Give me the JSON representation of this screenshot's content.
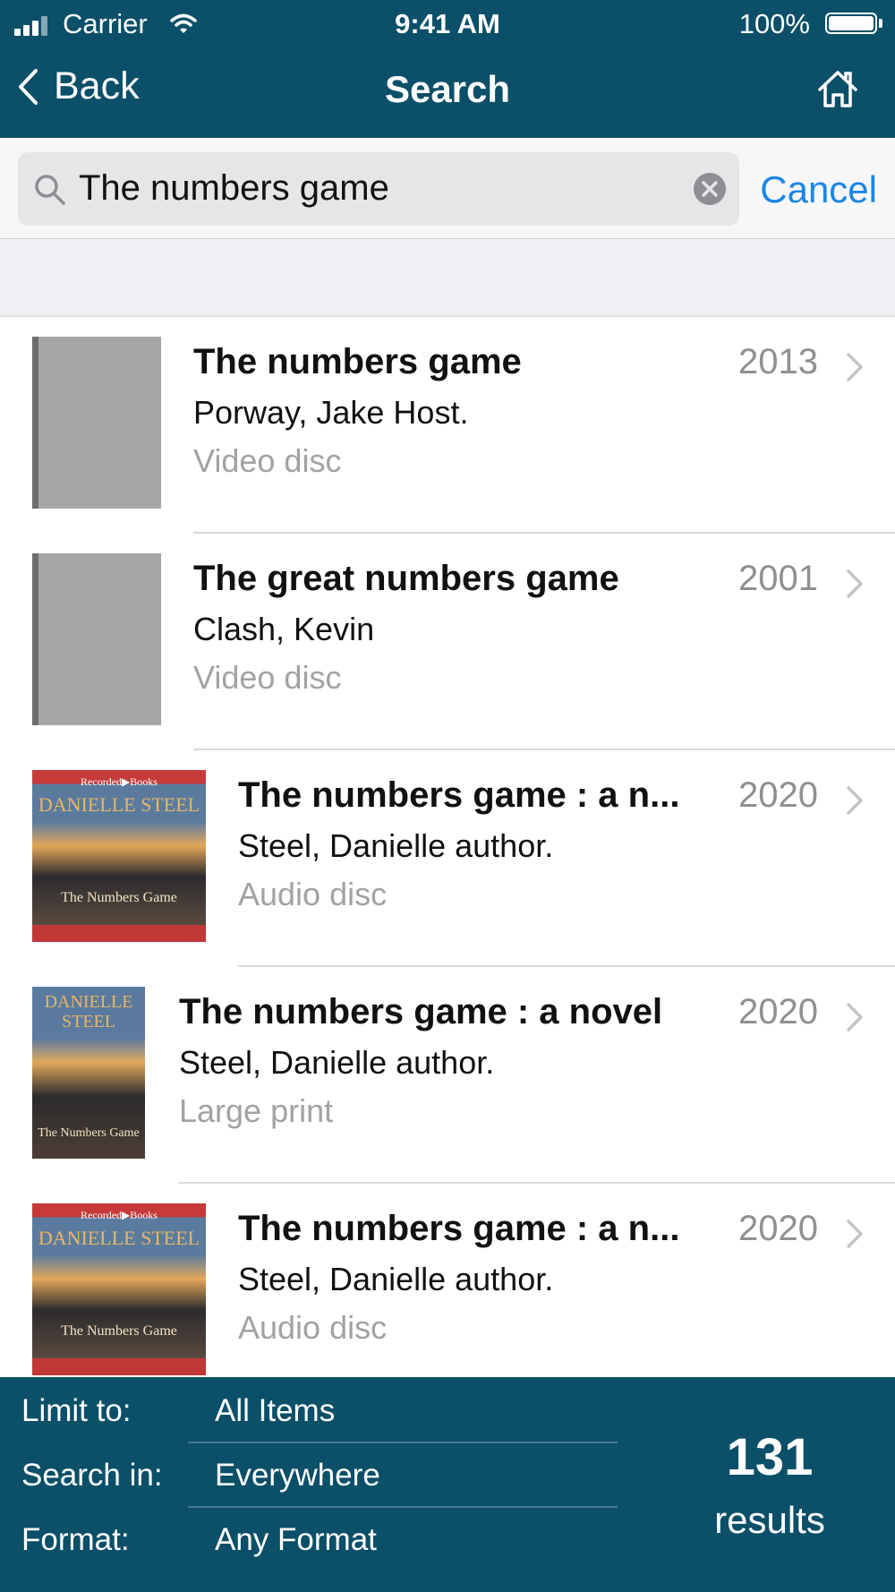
{
  "status_bar": {
    "carrier": "Carrier",
    "time": "9:41 AM",
    "battery": "100%"
  },
  "nav": {
    "back_label": "Back",
    "title": "Search"
  },
  "search": {
    "query": "The numbers game",
    "cancel_label": "Cancel"
  },
  "results": [
    {
      "title": "The numbers game",
      "year": "2013",
      "author": "Porway, Jake Host.",
      "format": "Video disc"
    },
    {
      "title": "The great numbers game",
      "year": "2001",
      "author": "Clash, Kevin",
      "format": "Video disc"
    },
    {
      "title": "The numbers game : a n...",
      "year": "2020",
      "author": "Steel, Danielle author.",
      "format": "Audio disc",
      "cover": {
        "publisher": "Recorded▶Books",
        "author": "DANIELLE STEEL",
        "title": "The Numbers Game"
      }
    },
    {
      "title": "The numbers game : a novel",
      "year": "2020",
      "author": "Steel, Danielle author.",
      "format": "Large print",
      "cover": {
        "author": "DANIELLE STEEL",
        "title": "The Numbers Game"
      }
    },
    {
      "title": "The numbers game : a n...",
      "year": "2020",
      "author": "Steel, Danielle author.",
      "format": "Audio disc",
      "cover": {
        "publisher": "Recorded▶Books",
        "author": "DANIELLE STEEL",
        "title": "The Numbers Game"
      }
    }
  ],
  "filters": {
    "limit_label": "Limit to:",
    "limit_value": "All Items",
    "search_in_label": "Search in:",
    "search_in_value": "Everywhere",
    "format_label": "Format:",
    "format_value": "Any Format"
  },
  "summary": {
    "count": "131",
    "label": "results"
  },
  "colors": {
    "header_bg": "#0b4f68",
    "accent": "#1a86e6"
  }
}
